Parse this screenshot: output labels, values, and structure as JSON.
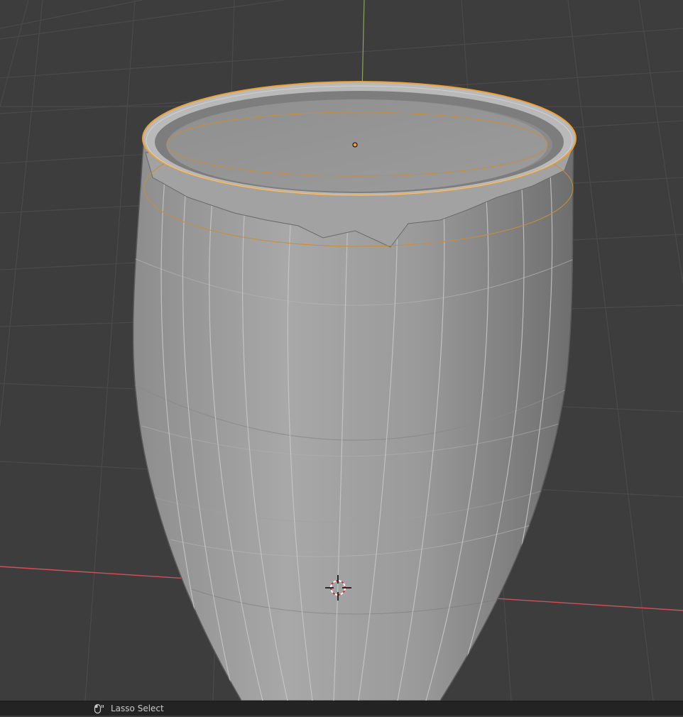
{
  "statusbar": {
    "mouse_icon": "mouse-left-click-icon",
    "action_label": "Lasso Select"
  },
  "viewport": {
    "selected_color": "#f0a030",
    "x_axis_color": "#d0505a",
    "y_axis_color": "#8ba35a",
    "background_color": "#3d3d3d",
    "grid_color": "#4a4a4a"
  }
}
